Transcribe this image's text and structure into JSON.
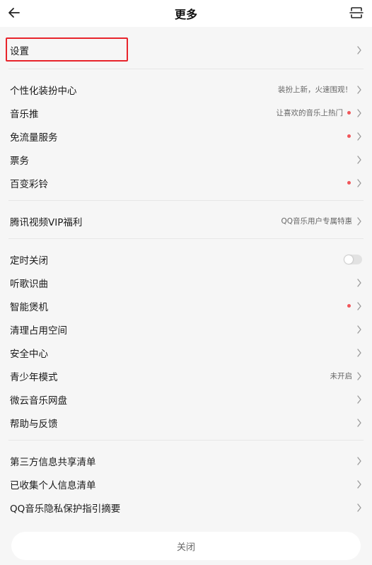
{
  "header": {
    "title": "更多",
    "back_icon": "arrow-left-icon",
    "scan_icon": "scan-icon"
  },
  "sections": [
    {
      "items": [
        {
          "label": "设置"
        }
      ]
    },
    {
      "items": [
        {
          "label": "个性化装扮中心",
          "sub": "装扮上新，火速围观！"
        },
        {
          "label": "音乐推",
          "sub": "让喜欢的音乐上热门",
          "dot": true
        },
        {
          "label": "免流量服务",
          "dot": true
        },
        {
          "label": "票务"
        },
        {
          "label": "百变彩铃",
          "dot": true
        }
      ]
    },
    {
      "items": [
        {
          "label": "腾讯视频VIP福利",
          "sub": "QQ音乐用户专属特惠"
        }
      ]
    },
    {
      "items": [
        {
          "label": "定时关闭",
          "toggle": true
        },
        {
          "label": "听歌识曲"
        },
        {
          "label": "智能煲机",
          "dot": true
        },
        {
          "label": "清理占用空间"
        },
        {
          "label": "安全中心"
        },
        {
          "label": "青少年模式",
          "sub": "未开启"
        },
        {
          "label": "微云音乐网盘"
        },
        {
          "label": "帮助与反馈"
        }
      ]
    },
    {
      "items": [
        {
          "label": "第三方信息共享清单"
        },
        {
          "label": "已收集个人信息清单"
        },
        {
          "label": "QQ音乐隐私保护指引摘要"
        }
      ]
    }
  ],
  "footer": {
    "close_label": "关闭"
  },
  "colors": {
    "accent_dot": "#f0565a",
    "highlight_border": "#e8242b"
  }
}
